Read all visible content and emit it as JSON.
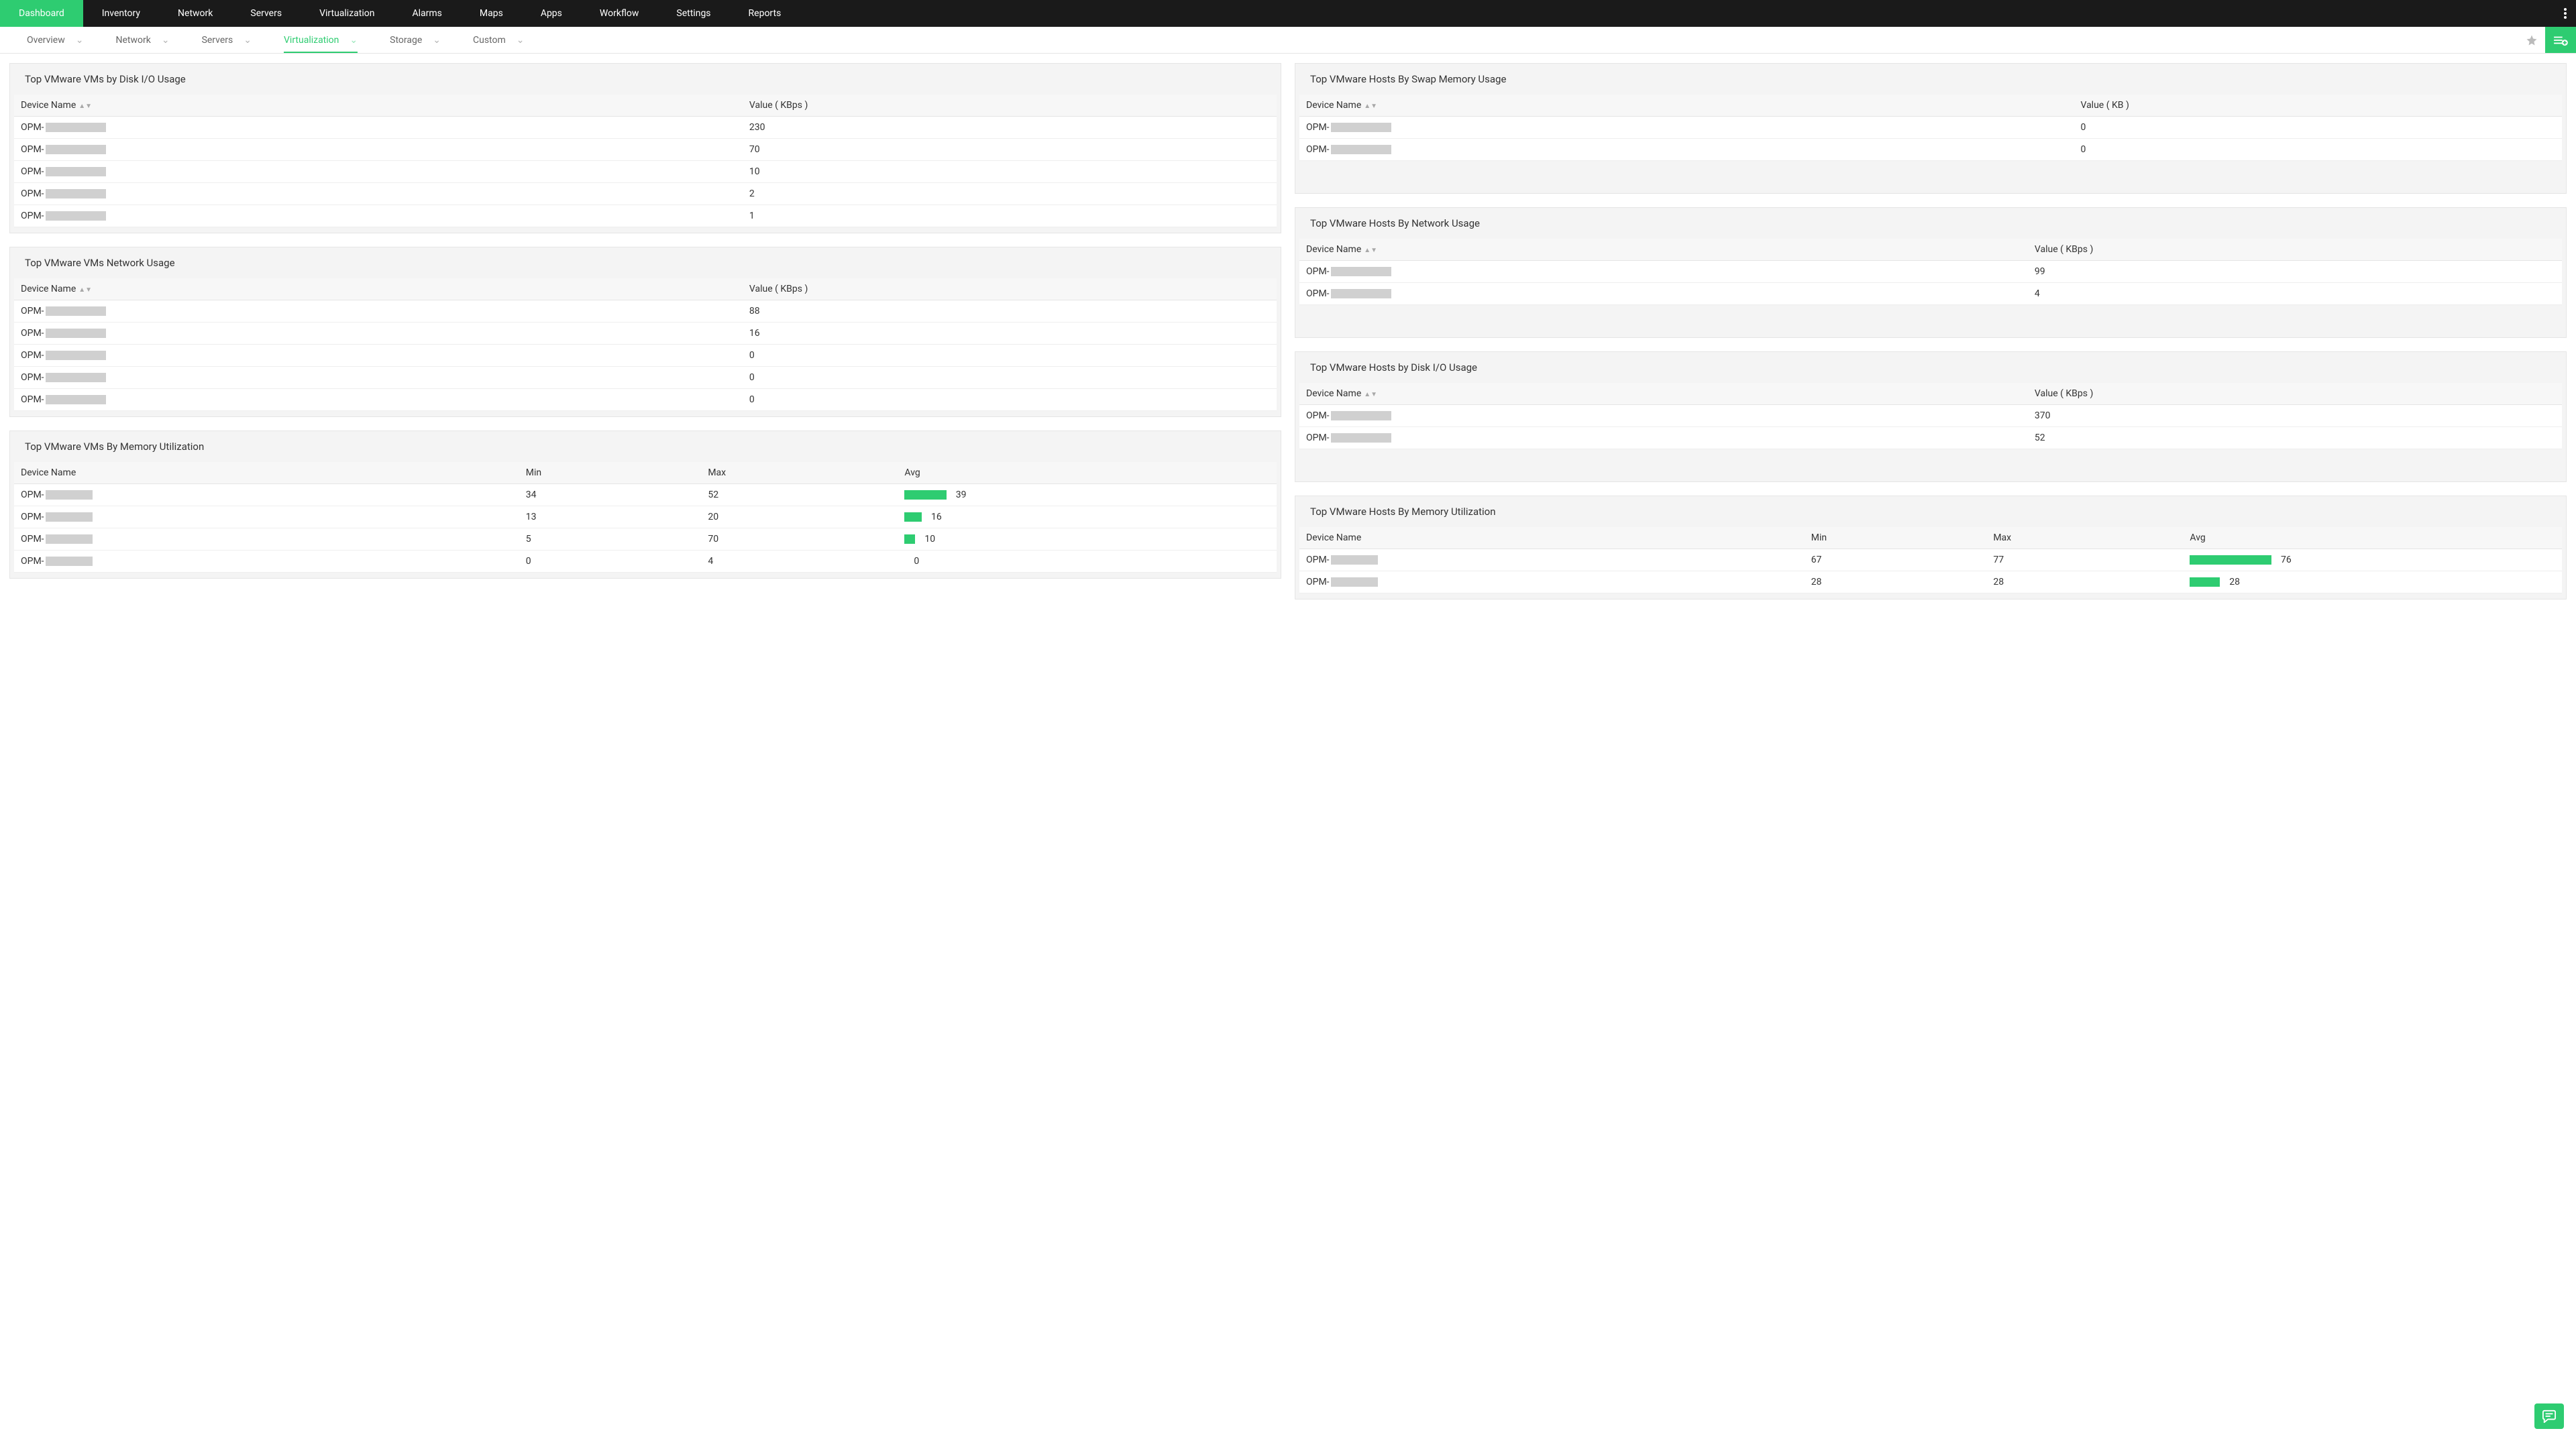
{
  "accent": "#2ecc71",
  "topnav": {
    "items": [
      {
        "label": "Dashboard",
        "active": true
      },
      {
        "label": "Inventory"
      },
      {
        "label": "Network"
      },
      {
        "label": "Servers"
      },
      {
        "label": "Virtualization"
      },
      {
        "label": "Alarms"
      },
      {
        "label": "Maps"
      },
      {
        "label": "Apps"
      },
      {
        "label": "Workflow"
      },
      {
        "label": "Settings"
      },
      {
        "label": "Reports"
      }
    ]
  },
  "subnav": {
    "tabs": [
      {
        "label": "Overview"
      },
      {
        "label": "Network"
      },
      {
        "label": "Servers"
      },
      {
        "label": "Virtualization",
        "active": true
      },
      {
        "label": "Storage"
      },
      {
        "label": "Custom"
      }
    ]
  },
  "widgets": {
    "vm_diskio": {
      "title": "Top VMware VMs by Disk I/O Usage",
      "cols": [
        "Device Name",
        "Value ( KBps )"
      ],
      "rows": [
        {
          "name": "OPM-",
          "value": "230"
        },
        {
          "name": "OPM-",
          "value": "70"
        },
        {
          "name": "OPM-",
          "value": "10"
        },
        {
          "name": "OPM-",
          "value": "2"
        },
        {
          "name": "OPM-",
          "value": "1"
        }
      ]
    },
    "vm_net": {
      "title": "Top VMware VMs Network Usage",
      "cols": [
        "Device Name",
        "Value ( KBps )"
      ],
      "rows": [
        {
          "name": "OPM-",
          "value": "88"
        },
        {
          "name": "OPM-",
          "value": "16"
        },
        {
          "name": "OPM-",
          "value": "0"
        },
        {
          "name": "OPM-",
          "value": "0"
        },
        {
          "name": "OPM-",
          "value": "0"
        }
      ]
    },
    "vm_mem": {
      "title": "Top VMware VMs By Memory Utilization",
      "cols": [
        "Device Name",
        "Min",
        "Max",
        "Avg"
      ],
      "rows": [
        {
          "name": "OPM-",
          "min": "34",
          "max": "52",
          "avg": 39
        },
        {
          "name": "OPM-",
          "min": "13",
          "max": "20",
          "avg": 16
        },
        {
          "name": "OPM-",
          "min": "5",
          "max": "70",
          "avg": 10
        },
        {
          "name": "OPM-",
          "min": "0",
          "max": "4",
          "avg": 0
        }
      ]
    },
    "host_swap": {
      "title": "Top VMware Hosts By Swap Memory Usage",
      "cols": [
        "Device Name",
        "Value ( KB )"
      ],
      "rows": [
        {
          "name": "OPM-",
          "value": "0"
        },
        {
          "name": "OPM-",
          "value": "0"
        }
      ]
    },
    "host_net": {
      "title": "Top VMware Hosts By Network Usage",
      "cols": [
        "Device Name",
        "Value ( KBps )"
      ],
      "rows": [
        {
          "name": "OPM-",
          "value": "99"
        },
        {
          "name": "OPM-",
          "value": "4"
        }
      ]
    },
    "host_diskio": {
      "title": "Top VMware Hosts by Disk I/O Usage",
      "cols": [
        "Device Name",
        "Value ( KBps )"
      ],
      "rows": [
        {
          "name": "OPM-",
          "value": "370"
        },
        {
          "name": "OPM-",
          "value": "52"
        }
      ]
    },
    "host_mem": {
      "title": "Top VMware Hosts By Memory Utilization",
      "cols": [
        "Device Name",
        "Min",
        "Max",
        "Avg"
      ],
      "rows": [
        {
          "name": "OPM-",
          "min": "67",
          "max": "77",
          "avg": 76
        },
        {
          "name": "OPM-",
          "min": "28",
          "max": "28",
          "avg": 28
        }
      ]
    }
  }
}
